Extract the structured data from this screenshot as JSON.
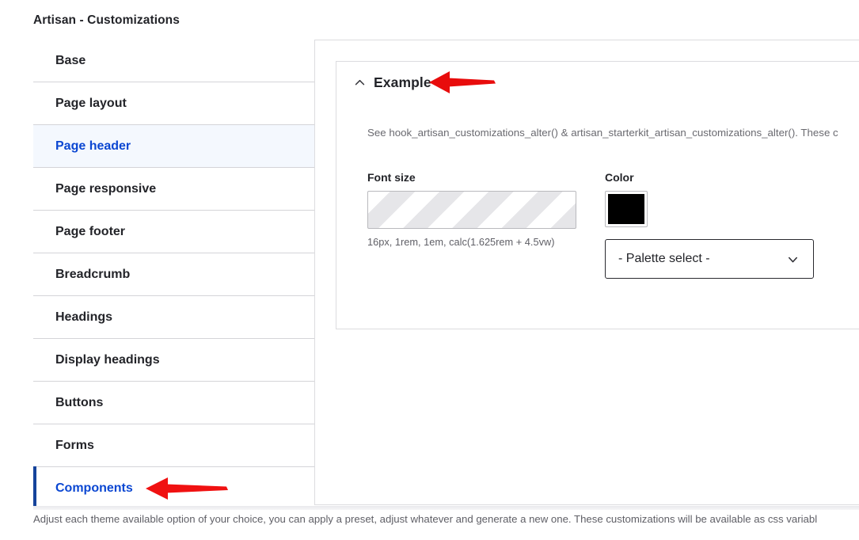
{
  "page": {
    "title": "Artisan - Customizations",
    "bottom_description": "Adjust each theme available option of your choice, you can apply a preset, adjust whatever and generate a new one. These customizations will be available as css variabl"
  },
  "sidebar": {
    "items": [
      {
        "label": "Base",
        "state": "default"
      },
      {
        "label": "Page layout",
        "state": "default"
      },
      {
        "label": "Page header",
        "state": "active"
      },
      {
        "label": "Page responsive",
        "state": "default"
      },
      {
        "label": "Page footer",
        "state": "default"
      },
      {
        "label": "Breadcrumb",
        "state": "default"
      },
      {
        "label": "Headings",
        "state": "default"
      },
      {
        "label": "Display headings",
        "state": "default"
      },
      {
        "label": "Buttons",
        "state": "default"
      },
      {
        "label": "Forms",
        "state": "default"
      },
      {
        "label": "Components",
        "state": "selected"
      }
    ]
  },
  "details": {
    "title": "Example",
    "toggle_icon": "chevron-up-icon",
    "description": "See hook_artisan_customizations_alter() & artisan_starterkit_artisan_customizations_alter(). These c",
    "font_size": {
      "label": "Font size",
      "value": "",
      "placeholder": "",
      "help": "16px, 1rem, 1em, calc(1.625rem + 4.5vw)",
      "disabled": true
    },
    "color": {
      "label": "Color",
      "swatch_value": "#000000",
      "palette_select": {
        "selected": "- Palette select -",
        "icon": "chevron-down-icon"
      }
    }
  },
  "annotations": {
    "arrow_color": "#e60000",
    "arrows": [
      {
        "name": "arrow-pointing-to-example",
        "direction": "left"
      },
      {
        "name": "arrow-pointing-to-components",
        "direction": "left"
      }
    ]
  },
  "colors": {
    "accent_blue": "#0b47d2",
    "accent_bar": "#15439b",
    "active_row_bg": "#f4f8fe",
    "border": "#d4d4d8",
    "text": "#232429",
    "muted_text": "#6a6a70"
  }
}
